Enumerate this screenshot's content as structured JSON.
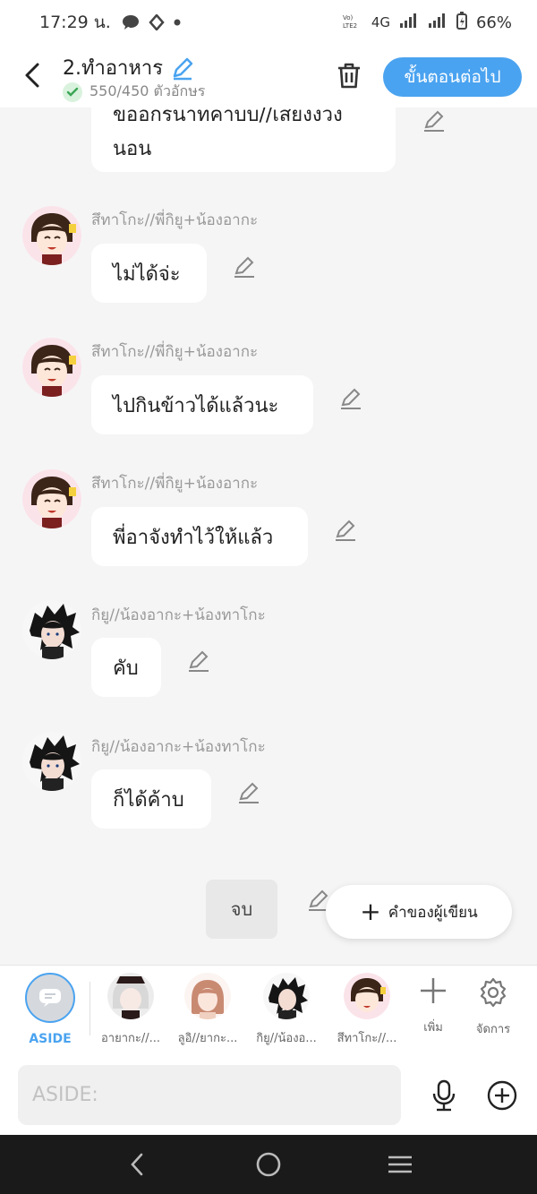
{
  "status_bar": {
    "time": "17:29 น.",
    "network": "4G",
    "battery": "66%"
  },
  "header": {
    "title": "2.ทำอาหาร",
    "char_count": "550/450 ตัวอักษร",
    "next_label": "ขั้นตอนต่อไป"
  },
  "chat": {
    "top_bubble_text": "ขออกรนาทคาบบ//เสยงงวง นอน",
    "messages": [
      {
        "sender": "สึทาโกะ//พี่กิยู+น้องอากะ",
        "text": "ไม่ได้จ่ะ"
      },
      {
        "sender": "สึทาโกะ//พี่กิยู+น้องอากะ",
        "text": "ไปกินข้าวได้แล้วนะ"
      },
      {
        "sender": "สึทาโกะ//พี่กิยู+น้องอากะ",
        "text": "พี่อาจังทำไว้ให้แล้ว"
      },
      {
        "sender": "กิยู//น้องอากะ+น้องทาโกะ",
        "text": "คับ"
      },
      {
        "sender": "กิยู//น้องอากะ+น้องทาโกะ",
        "text": "ก็ได้ค้าบ"
      }
    ],
    "end_label": "จบ",
    "author_button_label": "คำของผู้เขียน"
  },
  "characters": [
    {
      "label": "ASIDE"
    },
    {
      "label": "อายากะ//..."
    },
    {
      "label": "ลูอิ//ยากะ..."
    },
    {
      "label": "กิยู//น้องอ..."
    },
    {
      "label": "สึทาโกะ//..."
    }
  ],
  "tools": {
    "add_label": "เพิ่ม",
    "manage_label": "จัดการ"
  },
  "input": {
    "placeholder": "ASIDE:"
  },
  "colors": {
    "accent": "#4aa3f0",
    "background": "#f5f5f5",
    "bubble": "#ffffff"
  }
}
